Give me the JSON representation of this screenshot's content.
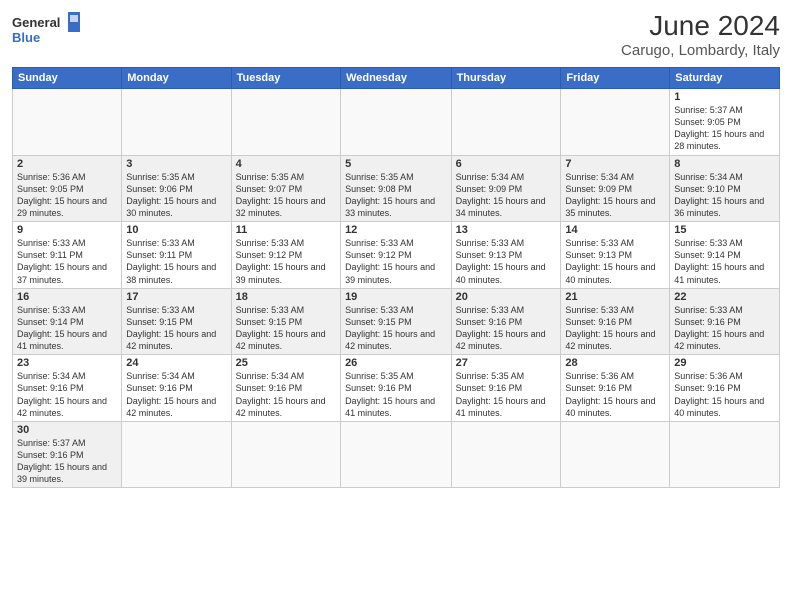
{
  "header": {
    "logo_general": "General",
    "logo_blue": "Blue",
    "title": "June 2024",
    "subtitle": "Carugo, Lombardy, Italy"
  },
  "weekdays": [
    "Sunday",
    "Monday",
    "Tuesday",
    "Wednesday",
    "Thursday",
    "Friday",
    "Saturday"
  ],
  "weeks": [
    [
      {
        "day": "",
        "info": ""
      },
      {
        "day": "",
        "info": ""
      },
      {
        "day": "",
        "info": ""
      },
      {
        "day": "",
        "info": ""
      },
      {
        "day": "",
        "info": ""
      },
      {
        "day": "",
        "info": ""
      },
      {
        "day": "1",
        "info": "Sunrise: 5:37 AM\nSunset: 9:05 PM\nDaylight: 15 hours and 28 minutes."
      }
    ],
    [
      {
        "day": "2",
        "info": "Sunrise: 5:36 AM\nSunset: 9:05 PM\nDaylight: 15 hours and 29 minutes."
      },
      {
        "day": "3",
        "info": "Sunrise: 5:35 AM\nSunset: 9:06 PM\nDaylight: 15 hours and 30 minutes."
      },
      {
        "day": "4",
        "info": "Sunrise: 5:35 AM\nSunset: 9:07 PM\nDaylight: 15 hours and 32 minutes."
      },
      {
        "day": "5",
        "info": "Sunrise: 5:35 AM\nSunset: 9:08 PM\nDaylight: 15 hours and 33 minutes."
      },
      {
        "day": "6",
        "info": "Sunrise: 5:34 AM\nSunset: 9:09 PM\nDaylight: 15 hours and 34 minutes."
      },
      {
        "day": "7",
        "info": "Sunrise: 5:34 AM\nSunset: 9:09 PM\nDaylight: 15 hours and 35 minutes."
      },
      {
        "day": "8",
        "info": "Sunrise: 5:34 AM\nSunset: 9:10 PM\nDaylight: 15 hours and 36 minutes."
      }
    ],
    [
      {
        "day": "9",
        "info": "Sunrise: 5:33 AM\nSunset: 9:11 PM\nDaylight: 15 hours and 37 minutes."
      },
      {
        "day": "10",
        "info": "Sunrise: 5:33 AM\nSunset: 9:11 PM\nDaylight: 15 hours and 38 minutes."
      },
      {
        "day": "11",
        "info": "Sunrise: 5:33 AM\nSunset: 9:12 PM\nDaylight: 15 hours and 39 minutes."
      },
      {
        "day": "12",
        "info": "Sunrise: 5:33 AM\nSunset: 9:12 PM\nDaylight: 15 hours and 39 minutes."
      },
      {
        "day": "13",
        "info": "Sunrise: 5:33 AM\nSunset: 9:13 PM\nDaylight: 15 hours and 40 minutes."
      },
      {
        "day": "14",
        "info": "Sunrise: 5:33 AM\nSunset: 9:13 PM\nDaylight: 15 hours and 40 minutes."
      },
      {
        "day": "15",
        "info": "Sunrise: 5:33 AM\nSunset: 9:14 PM\nDaylight: 15 hours and 41 minutes."
      }
    ],
    [
      {
        "day": "16",
        "info": "Sunrise: 5:33 AM\nSunset: 9:14 PM\nDaylight: 15 hours and 41 minutes."
      },
      {
        "day": "17",
        "info": "Sunrise: 5:33 AM\nSunset: 9:15 PM\nDaylight: 15 hours and 42 minutes."
      },
      {
        "day": "18",
        "info": "Sunrise: 5:33 AM\nSunset: 9:15 PM\nDaylight: 15 hours and 42 minutes."
      },
      {
        "day": "19",
        "info": "Sunrise: 5:33 AM\nSunset: 9:15 PM\nDaylight: 15 hours and 42 minutes."
      },
      {
        "day": "20",
        "info": "Sunrise: 5:33 AM\nSunset: 9:16 PM\nDaylight: 15 hours and 42 minutes."
      },
      {
        "day": "21",
        "info": "Sunrise: 5:33 AM\nSunset: 9:16 PM\nDaylight: 15 hours and 42 minutes."
      },
      {
        "day": "22",
        "info": "Sunrise: 5:33 AM\nSunset: 9:16 PM\nDaylight: 15 hours and 42 minutes."
      }
    ],
    [
      {
        "day": "23",
        "info": "Sunrise: 5:34 AM\nSunset: 9:16 PM\nDaylight: 15 hours and 42 minutes."
      },
      {
        "day": "24",
        "info": "Sunrise: 5:34 AM\nSunset: 9:16 PM\nDaylight: 15 hours and 42 minutes."
      },
      {
        "day": "25",
        "info": "Sunrise: 5:34 AM\nSunset: 9:16 PM\nDaylight: 15 hours and 42 minutes."
      },
      {
        "day": "26",
        "info": "Sunrise: 5:35 AM\nSunset: 9:16 PM\nDaylight: 15 hours and 41 minutes."
      },
      {
        "day": "27",
        "info": "Sunrise: 5:35 AM\nSunset: 9:16 PM\nDaylight: 15 hours and 41 minutes."
      },
      {
        "day": "28",
        "info": "Sunrise: 5:36 AM\nSunset: 9:16 PM\nDaylight: 15 hours and 40 minutes."
      },
      {
        "day": "29",
        "info": "Sunrise: 5:36 AM\nSunset: 9:16 PM\nDaylight: 15 hours and 40 minutes."
      }
    ],
    [
      {
        "day": "30",
        "info": "Sunrise: 5:37 AM\nSunset: 9:16 PM\nDaylight: 15 hours and 39 minutes."
      },
      {
        "day": "",
        "info": ""
      },
      {
        "day": "",
        "info": ""
      },
      {
        "day": "",
        "info": ""
      },
      {
        "day": "",
        "info": ""
      },
      {
        "day": "",
        "info": ""
      },
      {
        "day": "",
        "info": ""
      }
    ]
  ]
}
